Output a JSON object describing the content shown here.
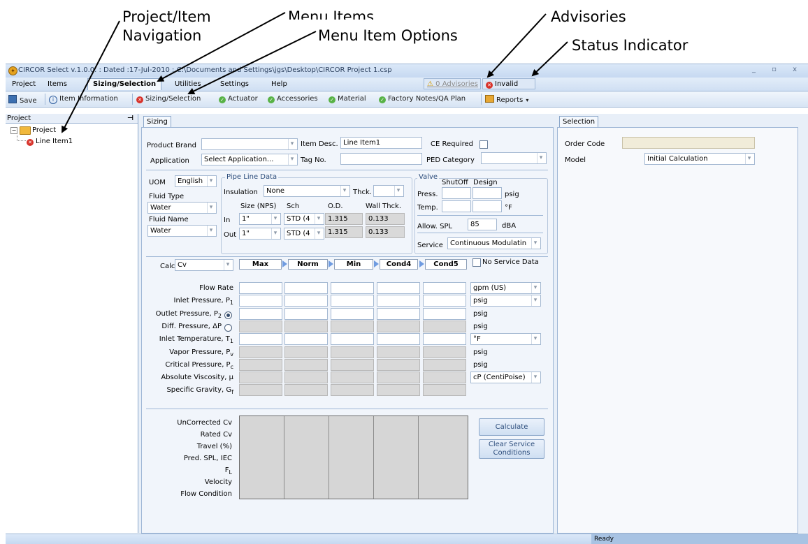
{
  "annotations": {
    "project_nav_line1": "Project/Item",
    "project_nav_line2": "Navigation",
    "menu_items": "Menu Items",
    "menu_item_options": "Menu Item Options",
    "advisories": "Advisories",
    "status_indicator": "Status Indicator"
  },
  "window": {
    "title": "CIRCOR Select v.1.0.0. : Dated :17-Jul-2010 : C:\\Documents and Settings\\jgs\\Desktop\\CIRCOR Project 1.csp",
    "controls": "_ ▫ x"
  },
  "menu": {
    "items": [
      "Project",
      "Items",
      "Sizing/Selection",
      "Utilities",
      "Settings",
      "Help"
    ],
    "advisories": "0 Advisories",
    "status": "Invalid"
  },
  "toolbar": {
    "save": "Save",
    "item_information": "Item Information",
    "sizing_selection": "Sizing/Selection",
    "actuator": "Actuator",
    "accessories": "Accessories",
    "material": "Material",
    "factory_notes": "Factory Notes/QA Plan",
    "reports": "Reports"
  },
  "project_tree": {
    "header": "Project",
    "pin": "ᵖ",
    "root": "Project",
    "child": "Line Item1"
  },
  "sizing": {
    "tab": "Sizing",
    "product_brand_label": "Product Brand",
    "product_brand_value": "",
    "item_desc_label": "Item Desc.",
    "item_desc_value": "Line Item1",
    "ce_required_label": "CE Required",
    "application_label": "Application",
    "application_value": "Select Application...",
    "tag_no_label": "Tag No.",
    "tag_no_value": "",
    "ped_category_label": "PED Category",
    "ped_category_value": "",
    "uom_label": "UOM",
    "uom_value": "English",
    "fluid_type_label": "Fluid Type",
    "fluid_type_value": "Water",
    "fluid_name_label": "Fluid Name",
    "fluid_name_value": "Water",
    "pipe": {
      "group_label": "Pipe Line Data",
      "insulation_label": "Insulation",
      "insulation_value": "None",
      "thck_label": "Thck.",
      "thck_value": "",
      "size_hdr": "Size (NPS)",
      "sch_hdr": "Sch",
      "od_hdr": "O.D.",
      "wall_hdr": "Wall Thck.",
      "in_label": "In",
      "out_label": "Out",
      "in_size": "1\"",
      "in_sch": "STD (4",
      "in_od": "1.315",
      "in_wall": "0.133",
      "out_size": "1\"",
      "out_sch": "STD (4",
      "out_od": "1.315",
      "out_wall": "0.133"
    },
    "valve": {
      "group_label": "Valve",
      "shutoff_hdr": "ShutOff",
      "design_hdr": "Design",
      "press_label": "Press.",
      "press_unit": "psig",
      "temp_label": "Temp.",
      "temp_unit": "°F",
      "allow_spl_label": "Allow. SPL",
      "allow_spl_value": "85",
      "allow_spl_unit": "dBA",
      "service_label": "Service",
      "service_value": "Continuous Modulatin"
    },
    "calc_label": "Calc",
    "calc_value": "Cv",
    "columns": [
      "Max",
      "Norm",
      "Min",
      "Cond4",
      "Cond5"
    ],
    "no_service_data": "No Service Data",
    "rows": [
      {
        "label": "Flow Rate",
        "sub": "",
        "unit": "gpm (US)",
        "unit_dd": true,
        "cells": "w"
      },
      {
        "label": "Inlet Pressure, P",
        "sub": "1",
        "unit": "psig",
        "unit_dd": true,
        "cells": "w"
      },
      {
        "label": "Outlet Pressure, P",
        "sub": "2",
        "unit": "psig",
        "unit_dd": false,
        "cells": "w"
      },
      {
        "label": "Diff. Pressure, ΔP",
        "sub": "",
        "unit": "psig",
        "unit_dd": false,
        "cells": "g"
      },
      {
        "label": "Inlet Temperature, T",
        "sub": "1",
        "unit": "°F",
        "unit_dd": true,
        "cells": "w"
      },
      {
        "label": "Vapor Pressure, P",
        "sub": "v",
        "unit": "psig",
        "unit_dd": false,
        "cells": "g"
      },
      {
        "label": "Critical Pressure, P",
        "sub": "c",
        "unit": "psig",
        "unit_dd": false,
        "cells": "g"
      },
      {
        "label": "Absolute Viscosity, μ",
        "sub": "",
        "unit": "cP (CentiPoise)",
        "unit_dd": true,
        "cells": "g"
      },
      {
        "label": "Specific Gravity, G",
        "sub": "f",
        "unit": "",
        "unit_dd": false,
        "cells": "g"
      }
    ],
    "results": [
      "UnCorrected Cv",
      "Rated Cv",
      "Travel (%)",
      "Pred. SPL, IEC",
      "F",
      "Velocity",
      "Flow Condition"
    ],
    "results_fl_sub": "L",
    "calculate": "Calculate",
    "clear_line1": "Clear Service",
    "clear_line2": "Conditions"
  },
  "selection": {
    "tab": "Selection",
    "order_code_label": "Order Code",
    "order_code_value": "",
    "model_label": "Model",
    "model_value": "Initial Calculation"
  },
  "status": {
    "ready": "Ready"
  }
}
